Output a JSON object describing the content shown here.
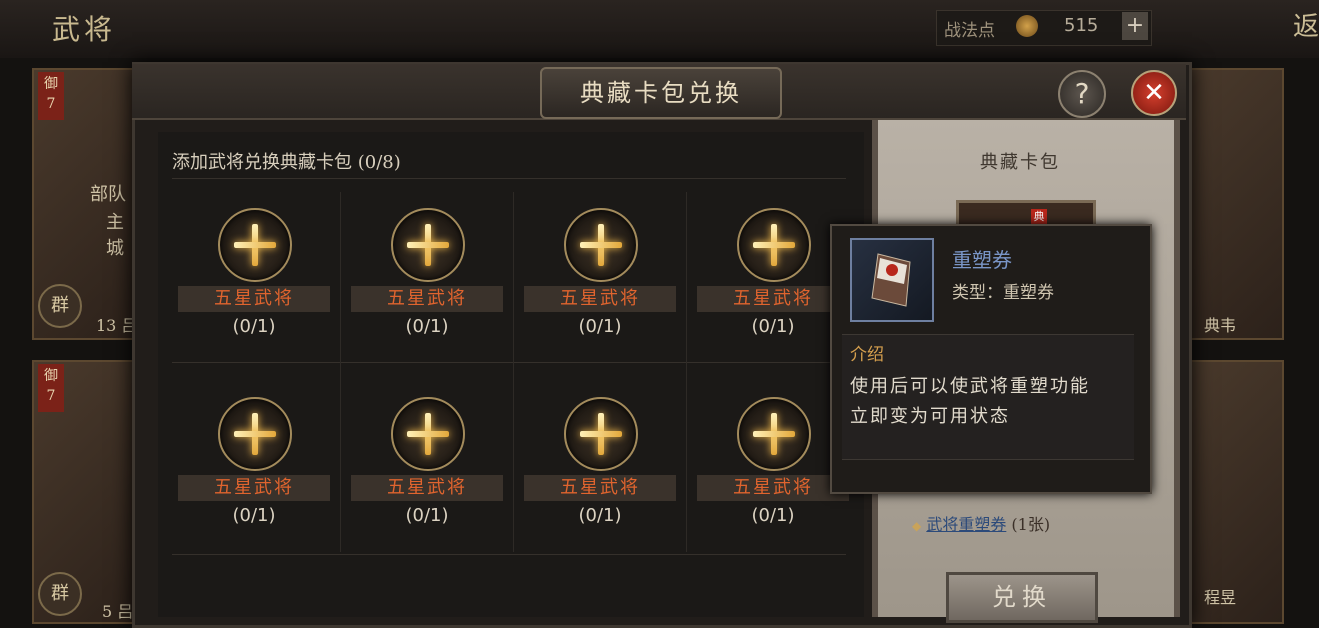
{
  "topbar": {
    "title": "武将",
    "resource_label": "战法点",
    "resource_value": "515",
    "plus": "+",
    "back_label": "返"
  },
  "background_cards": {
    "left_top": {
      "badge_line1": "御",
      "badge_line2": "7",
      "line1": "部队",
      "line2": "主城",
      "seal": "群",
      "footer": "13 吕"
    },
    "left_bottom": {
      "badge_line1": "御",
      "badge_line2": "7",
      "seal": "群",
      "footer": "5 吕"
    },
    "right_top": {
      "footer": "典韦"
    },
    "right_bottom": {
      "footer": "程昱"
    }
  },
  "modal": {
    "title": "典藏卡包兑换",
    "help_label": "?",
    "close_label": "✕",
    "add_title": "添加武将兑换典藏卡包 (0/8)",
    "slots": [
      {
        "label": "五星武将",
        "count": "(0/1)"
      },
      {
        "label": "五星武将",
        "count": "(0/1)"
      },
      {
        "label": "五星武将",
        "count": "(0/1)"
      },
      {
        "label": "五星武将",
        "count": "(0/1)"
      },
      {
        "label": "五星武将",
        "count": "(0/1)"
      },
      {
        "label": "五星武将",
        "count": "(0/1)"
      },
      {
        "label": "五星武将",
        "count": "(0/1)"
      },
      {
        "label": "五星武将",
        "count": "(0/1)"
      }
    ]
  },
  "right_panel": {
    "pack_title": "典藏卡包",
    "pack_seal": "典",
    "reward_bullet": "◆",
    "reward_name": "武将重塑券",
    "reward_qty": " (1张)",
    "exchange_label": "兑换"
  },
  "tooltip": {
    "item_name": "重塑券",
    "item_type": "类型：重塑券",
    "intro_heading": "介绍",
    "intro_line1": "使用后可以使武将重塑功能",
    "intro_line2": "立即变为可用状态"
  },
  "colors": {
    "accent_gold": "#e3a83a",
    "slot_label": "#e0642e",
    "item_name": "#7a96c8",
    "close_red": "#c0301f"
  }
}
